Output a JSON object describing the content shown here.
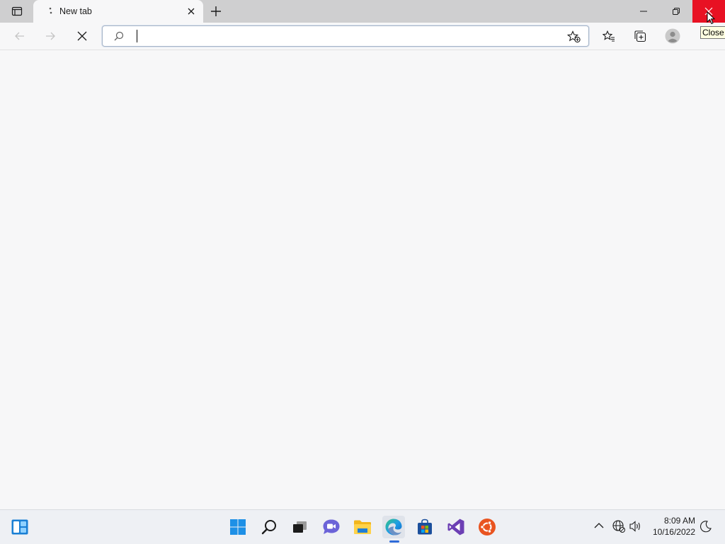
{
  "browser": {
    "tab": {
      "title": "New tab"
    },
    "address_bar": {
      "value": "",
      "placeholder": ""
    },
    "tooltip": "Close"
  },
  "taskbar": {
    "clock": {
      "time": "8:09 AM",
      "date": "10/16/2022"
    },
    "pinned": [
      "widgets-icon",
      "start-icon",
      "search-icon",
      "task-view-icon",
      "chat-icon",
      "file-explorer-icon",
      "edge-icon",
      "store-icon",
      "visual-studio-icon",
      "ubuntu-icon"
    ]
  },
  "colors": {
    "close_button": "#e81123",
    "page_background": "#f7f7f8",
    "tab_strip": "#cfcfd0",
    "taskbar": "#eef0f4"
  }
}
